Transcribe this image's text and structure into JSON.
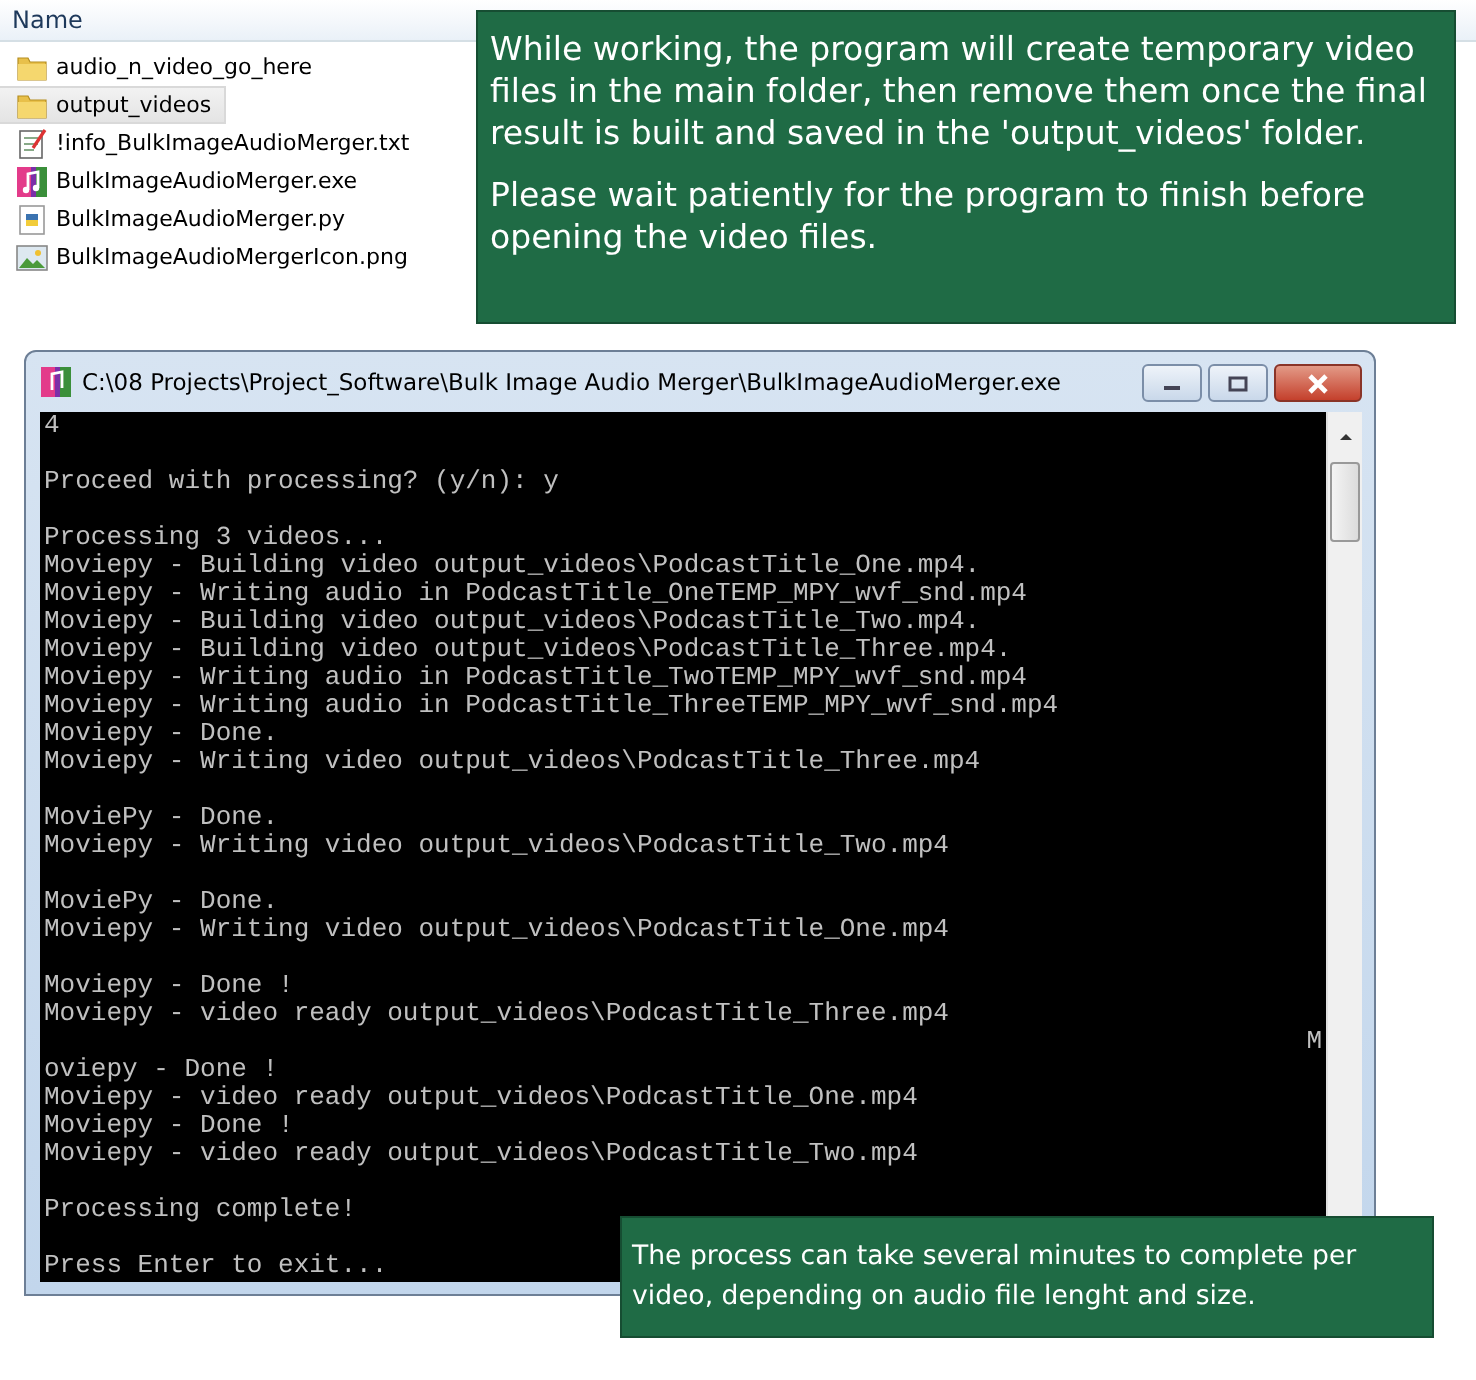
{
  "explorer": {
    "column_header": "Name",
    "files": [
      {
        "name": "audio_n_video_go_here",
        "kind": "folder",
        "selected": false
      },
      {
        "name": "output_videos",
        "kind": "folder",
        "selected": true
      },
      {
        "name": "!info_BulkImageAudioMerger.txt",
        "kind": "text",
        "selected": false
      },
      {
        "name": "BulkImageAudioMerger.exe",
        "kind": "exe",
        "selected": false
      },
      {
        "name": "BulkImageAudioMerger.py",
        "kind": "python",
        "selected": false
      },
      {
        "name": "BulkImageAudioMergerIcon.png",
        "kind": "image",
        "selected": false
      }
    ]
  },
  "console": {
    "title": "C:\\08 Projects\\Project_Software\\Bulk Image Audio Merger\\BulkImageAudioMerger.exe",
    "lines": [
      {
        "kind": "text",
        "text": "4"
      },
      {
        "kind": "blank"
      },
      {
        "kind": "text",
        "text": "Proceed with processing? (y/n): y"
      },
      {
        "kind": "blank"
      },
      {
        "kind": "text",
        "text": "Processing 3 videos..."
      },
      {
        "kind": "text",
        "text": "Moviepy - Building video output_videos\\PodcastTitle_One.mp4."
      },
      {
        "kind": "text",
        "text": "Moviepy - Writing audio in PodcastTitle_OneTEMP_MPY_wvf_snd.mp4"
      },
      {
        "kind": "text",
        "text": "Moviepy - Building video output_videos\\PodcastTitle_Two.mp4."
      },
      {
        "kind": "text",
        "text": "Moviepy - Building video output_videos\\PodcastTitle_Three.mp4."
      },
      {
        "kind": "text",
        "text": "Moviepy - Writing audio in PodcastTitle_TwoTEMP_MPY_wvf_snd.mp4"
      },
      {
        "kind": "text",
        "text": "Moviepy - Writing audio in PodcastTitle_ThreeTEMP_MPY_wvf_snd.mp4"
      },
      {
        "kind": "text",
        "text": "Moviepy - Done."
      },
      {
        "kind": "text",
        "text": "Moviepy - Writing video output_videos\\PodcastTitle_Three.mp4"
      },
      {
        "kind": "blank"
      },
      {
        "kind": "text",
        "text": "MoviePy - Done."
      },
      {
        "kind": "text",
        "text": "Moviepy - Writing video output_videos\\PodcastTitle_Two.mp4"
      },
      {
        "kind": "blank"
      },
      {
        "kind": "text",
        "text": "MoviePy - Done."
      },
      {
        "kind": "text",
        "text": "Moviepy - Writing video output_videos\\PodcastTitle_One.mp4"
      },
      {
        "kind": "blank"
      },
      {
        "kind": "text",
        "text": "Moviepy - Done !"
      },
      {
        "kind": "text",
        "text": "Moviepy - video ready output_videos\\PodcastTitle_Three.mp4"
      },
      {
        "kind": "wrap",
        "text": "M"
      },
      {
        "kind": "text",
        "text": "oviepy - Done !"
      },
      {
        "kind": "text",
        "text": "Moviepy - video ready output_videos\\PodcastTitle_One.mp4"
      },
      {
        "kind": "text",
        "text": "Moviepy - Done !"
      },
      {
        "kind": "text",
        "text": "Moviepy - video ready output_videos\\PodcastTitle_Two.mp4"
      },
      {
        "kind": "blank"
      },
      {
        "kind": "text",
        "text": "Processing complete!"
      },
      {
        "kind": "blank"
      },
      {
        "kind": "text",
        "text": "Press Enter to exit..."
      }
    ]
  },
  "notes": [
    {
      "paragraphs": [
        "While working, the program will create temporary video files in the main folder, then remove them once the final result is built and saved in the 'output_videos' folder.",
        "Please wait patiently for the program to finish before opening the video files."
      ]
    },
    {
      "paragraphs": [
        "The process can take several minutes to complete per video, depending on audio file lenght and size."
      ]
    }
  ]
}
